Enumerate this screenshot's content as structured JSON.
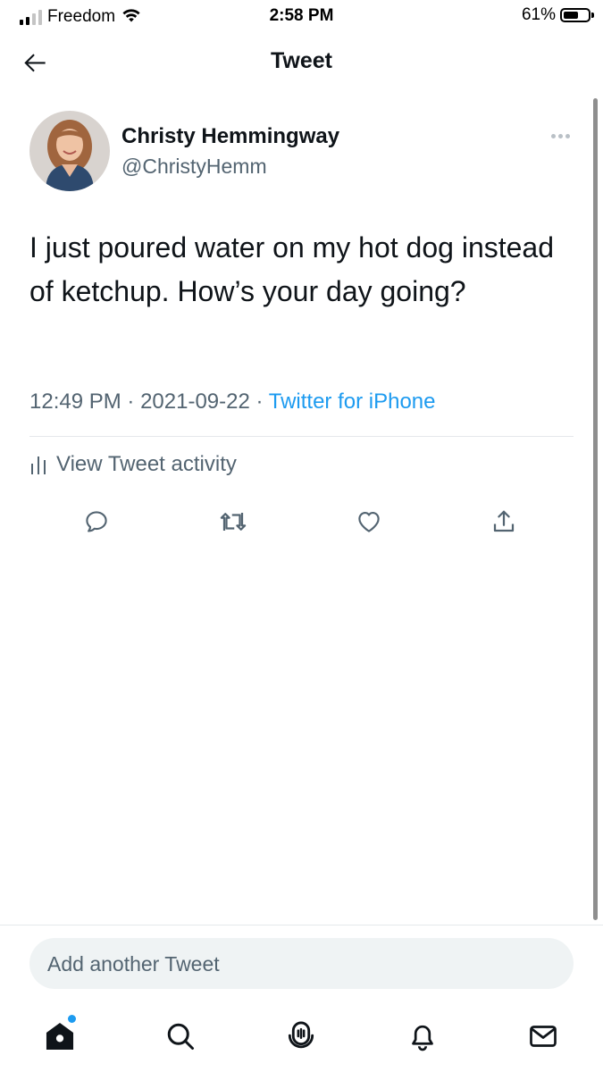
{
  "status_bar": {
    "carrier": "Freedom",
    "time": "2:58 PM",
    "battery_percent": "61%",
    "battery_level": 0.61,
    "signal_bars_active": 2,
    "signal_bars_total": 4
  },
  "header": {
    "title": "Tweet",
    "back_icon": "arrow-left-icon"
  },
  "tweet": {
    "author_name": "Christy Hemmingway",
    "author_handle": "@ChristyHemm",
    "text": "I just poured water on my hot dog instead of ketchup. How’s your day going?",
    "time": "12:49 PM",
    "date": "2021-09-22",
    "separator": "·",
    "source": "Twitter for iPhone",
    "activity_label": "View Tweet activity"
  },
  "actions": {
    "reply_icon": "reply-icon",
    "retweet_icon": "retweet-icon",
    "like_icon": "heart-icon",
    "share_icon": "share-icon"
  },
  "compose": {
    "placeholder": "Add another Tweet"
  },
  "tabbar": {
    "items": [
      "home-icon",
      "search-icon",
      "spaces-icon",
      "notifications-icon",
      "messages-icon"
    ]
  },
  "colors": {
    "accent": "#1d9bf0",
    "text_primary": "#0f1419",
    "text_secondary": "#536471",
    "compose_bg": "#eff3f4"
  }
}
